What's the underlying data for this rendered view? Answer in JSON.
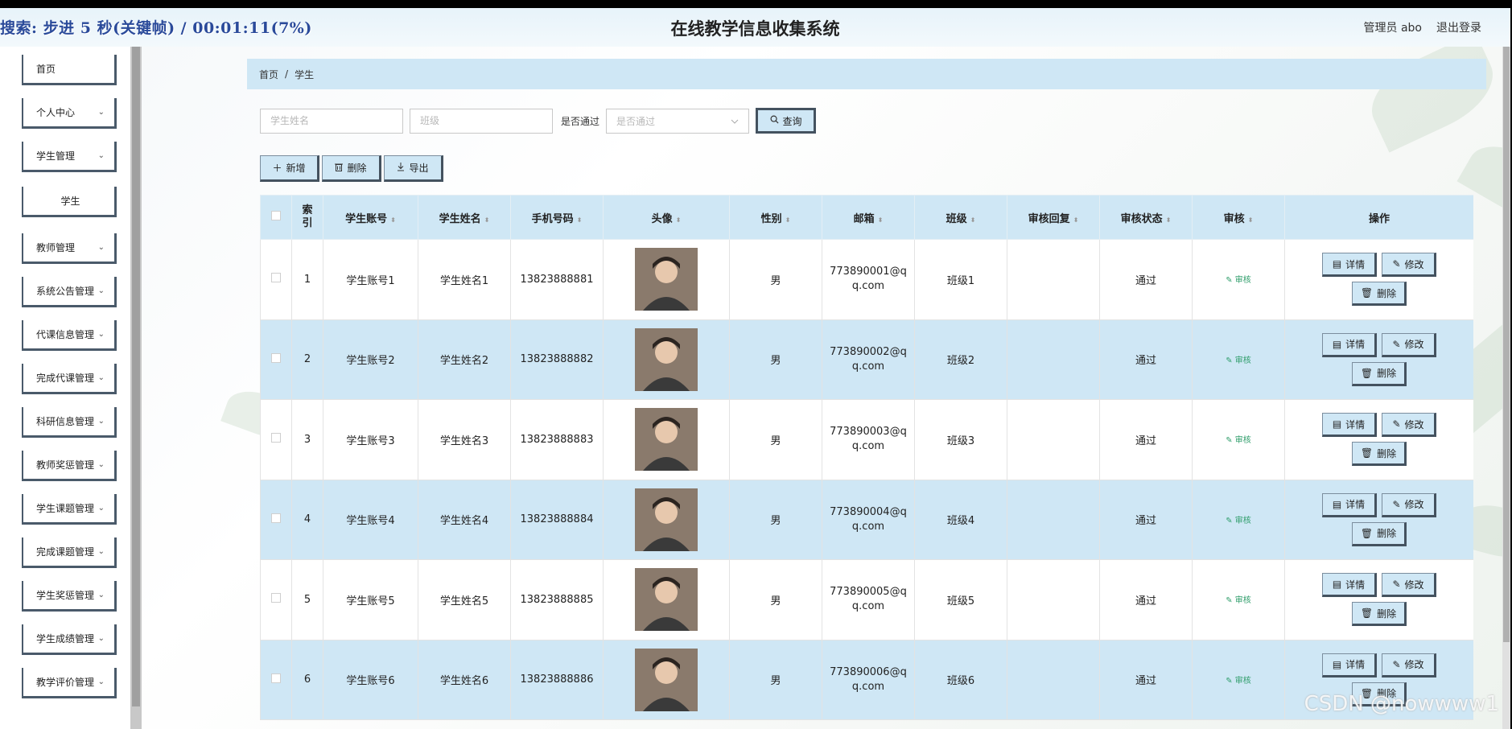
{
  "overlay": {
    "status": "搜索: 步进 5 秒(关键帧) / 00:01:11(7%)"
  },
  "header": {
    "title": "在线教学信息收集系统",
    "user": "管理员 abo",
    "logout": "退出登录"
  },
  "sidebar": {
    "items": [
      {
        "label": "首页",
        "chevron": ""
      },
      {
        "label": "个人中心",
        "chevron": "⌄"
      },
      {
        "label": "学生管理",
        "chevron": "⌄"
      },
      {
        "label": "学生",
        "chevron": ""
      },
      {
        "label": "教师管理",
        "chevron": "⌄"
      },
      {
        "label": "系统公告管理",
        "chevron": "⌄"
      },
      {
        "label": "代课信息管理",
        "chevron": "⌄"
      },
      {
        "label": "完成代课管理",
        "chevron": "⌄"
      },
      {
        "label": "科研信息管理",
        "chevron": "⌄"
      },
      {
        "label": "教师奖惩管理",
        "chevron": "⌄"
      },
      {
        "label": "学生课题管理",
        "chevron": "⌄"
      },
      {
        "label": "完成课题管理",
        "chevron": "⌄"
      },
      {
        "label": "学生奖惩管理",
        "chevron": "⌄"
      },
      {
        "label": "学生成绩管理",
        "chevron": "⌄"
      },
      {
        "label": "教学评价管理",
        "chevron": "⌄"
      }
    ]
  },
  "breadcrumb": {
    "home": "首页",
    "separator": "/",
    "current": "学生"
  },
  "search": {
    "name_placeholder": "学生姓名",
    "class_placeholder": "班级",
    "passed_label": "是否通过",
    "passed_placeholder": "是否通过",
    "query_label": "查询"
  },
  "actions": {
    "add": "新增",
    "delete": "删除",
    "export": "导出"
  },
  "table": {
    "headers": {
      "index": "索引",
      "account": "学生账号",
      "name": "学生姓名",
      "phone": "手机号码",
      "avatar": "头像",
      "gender": "性别",
      "email": "邮箱",
      "class": "班级",
      "reply": "审核回复",
      "status": "审核状态",
      "review": "审核",
      "ops": "操作"
    },
    "rows": [
      {
        "index": "1",
        "account": "学生账号1",
        "name": "学生姓名1",
        "phone": "13823888881",
        "gender": "男",
        "email_a": "773890001@q",
        "email_b": "q.com",
        "class": "班级1",
        "reply": "",
        "status": "通过",
        "review": "审核"
      },
      {
        "index": "2",
        "account": "学生账号2",
        "name": "学生姓名2",
        "phone": "13823888882",
        "gender": "男",
        "email_a": "773890002@q",
        "email_b": "q.com",
        "class": "班级2",
        "reply": "",
        "status": "通过",
        "review": "审核"
      },
      {
        "index": "3",
        "account": "学生账号3",
        "name": "学生姓名3",
        "phone": "13823888883",
        "gender": "男",
        "email_a": "773890003@q",
        "email_b": "q.com",
        "class": "班级3",
        "reply": "",
        "status": "通过",
        "review": "审核"
      },
      {
        "index": "4",
        "account": "学生账号4",
        "name": "学生姓名4",
        "phone": "13823888884",
        "gender": "男",
        "email_a": "773890004@q",
        "email_b": "q.com",
        "class": "班级4",
        "reply": "",
        "status": "通过",
        "review": "审核"
      },
      {
        "index": "5",
        "account": "学生账号5",
        "name": "学生姓名5",
        "phone": "13823888885",
        "gender": "男",
        "email_a": "773890005@q",
        "email_b": "q.com",
        "class": "班级5",
        "reply": "",
        "status": "通过",
        "review": "审核"
      },
      {
        "index": "6",
        "account": "学生账号6",
        "name": "学生姓名6",
        "phone": "13823888886",
        "gender": "男",
        "email_a": "773890006@q",
        "email_b": "q.com",
        "class": "班级6",
        "reply": "",
        "status": "通过",
        "review": "审核"
      }
    ],
    "row_ops": {
      "detail": "详情",
      "edit": "修改",
      "delete": "删除"
    }
  },
  "watermark": "CSDN @nowwww1",
  "colors": {
    "accent": "#cfe7f5",
    "button_border": "#44525f",
    "review_link": "#2e9d6a"
  },
  "icons": {
    "add": "plus-icon",
    "delete": "trash-icon",
    "export": "download-icon",
    "query": "search-icon",
    "detail": "document-icon",
    "edit": "pencil-icon",
    "review": "pencil-icon",
    "sort": "sort-icon",
    "chevron": "chevron-down-icon"
  }
}
